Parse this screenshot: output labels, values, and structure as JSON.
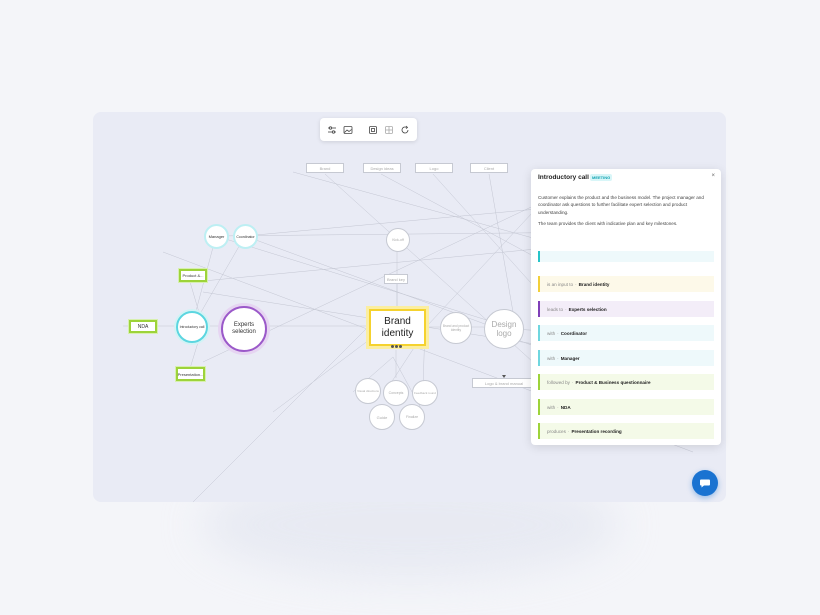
{
  "graph": {
    "top_labels": [
      "Brand",
      "Design ideas",
      "Logo",
      "Client"
    ],
    "manager": "Manager",
    "coordinator": "Coordinator",
    "product": "Product &...",
    "nda": "NDA",
    "intro_call": "Introductory call",
    "presentation": "Presentation...",
    "experts": "Experts selection",
    "brand_identity": "Brand identity",
    "kick_off": "Kick-off",
    "small_box": "Brand key",
    "design_logo": "Design logo",
    "right_node": "Brand and product identity",
    "bottom_box": "Logo & brand manual",
    "bottom_nodes": [
      "Visual directions",
      "Concepts",
      "Feedback round",
      "Guide",
      "Finalize"
    ],
    "brand_colors": [
      "#f5d22e",
      "#9dd33a",
      "#5cd6e0",
      "#9b59c9"
    ]
  },
  "toolbar": {
    "tools": [
      "sliders-icon",
      "image-icon",
      "frame-icon",
      "grid-icon",
      "refresh-icon"
    ]
  },
  "panel": {
    "title": "Introductory call",
    "badge": "MEETING",
    "close": "×",
    "paragraph1": "Customer explains the product and the business model. The project manager and coordinator ask questions to further facilitate expert selection and product understanding.",
    "paragraph2": "The team provides the client with indicative plan and key milestones.",
    "relations": [
      {
        "verb": "",
        "target": "",
        "color": "#27c4c9",
        "bg": "#eef9fb"
      },
      {
        "verb": "is an input to",
        "target": "Brand identity",
        "color": "#f2cf3a",
        "bg": "#fdf9e9"
      },
      {
        "verb": "leads to",
        "target": "Experts selection",
        "color": "#7f3fb8",
        "bg": "#f3edf8"
      },
      {
        "verb": "with",
        "target": "Coordinator",
        "color": "#6fd6df",
        "bg": "#eef9fb"
      },
      {
        "verb": "with",
        "target": "Manager",
        "color": "#6fd6df",
        "bg": "#eef9fb"
      },
      {
        "verb": "followed by",
        "target": "Product & Business questionnaire",
        "color": "#9dd33a",
        "bg": "#f4fae8"
      },
      {
        "verb": "with",
        "target": "NDA",
        "color": "#9dd33a",
        "bg": "#f4fae8"
      },
      {
        "verb": "produces",
        "target": "Presentation recording",
        "color": "#9dd33a",
        "bg": "#f4fae8"
      }
    ]
  },
  "chat": {
    "icon": "chat-icon"
  }
}
